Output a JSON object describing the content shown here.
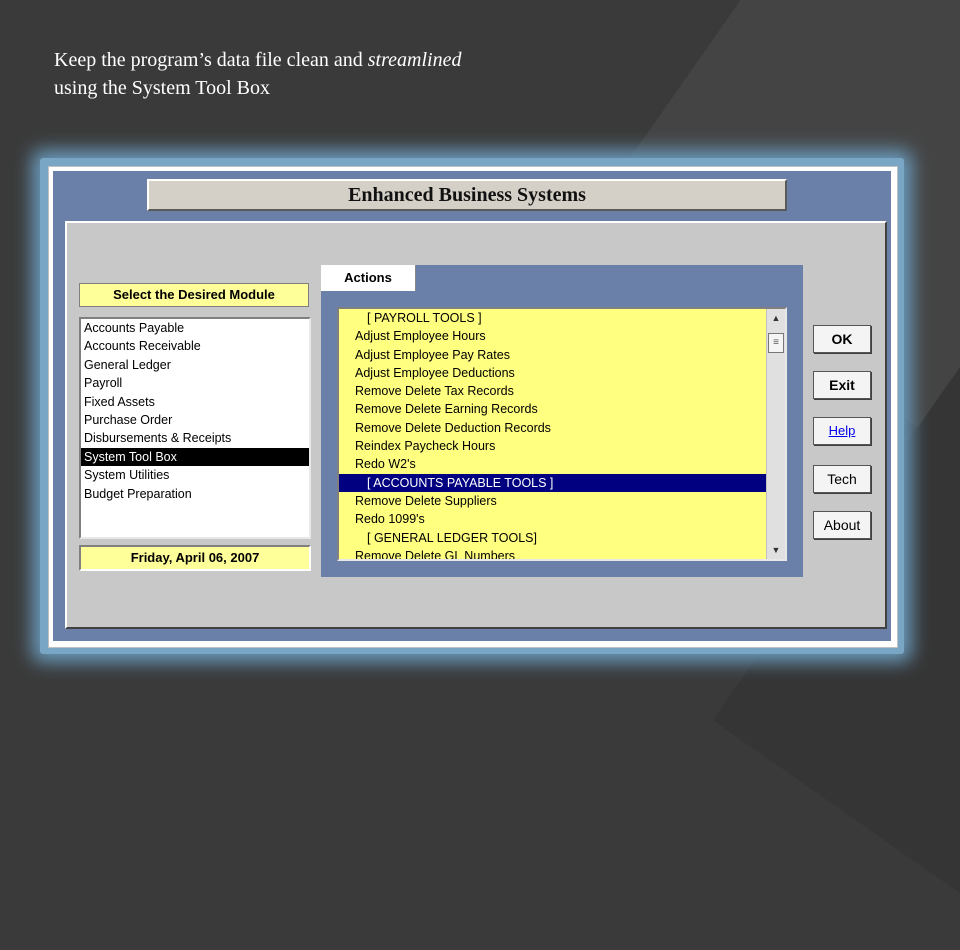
{
  "caption": {
    "line1_prefix": "Keep the program’s data file clean and ",
    "line1_emphasis": "streamlined",
    "line2": "using the System Tool Box"
  },
  "app": {
    "title": "Enhanced Business Systems"
  },
  "modules": {
    "header": "Select the Desired Module",
    "items": [
      "Accounts Payable",
      "Accounts Receivable",
      "General Ledger",
      "Payroll",
      "Fixed Assets",
      "Purchase Order",
      "Disbursements & Receipts",
      "System Tool Box",
      "System Utilities",
      "Budget Preparation"
    ],
    "selected": "System Tool Box",
    "date": "Friday, April 06, 2007"
  },
  "actions": {
    "tab_label": "Actions",
    "items": [
      "[ PAYROLL TOOLS ]",
      "Adjust Employee Hours",
      "Adjust Employee Pay Rates",
      "Adjust Employee Deductions",
      "Remove Delete Tax Records",
      "Remove Delete Earning Records",
      "Remove Delete Deduction Records",
      "Reindex Paycheck Hours",
      "Redo W2's",
      "[ ACCOUNTS PAYABLE TOOLS ]",
      "Remove Delete Suppliers",
      "Redo 1099's",
      "[ GENERAL LEDGER TOOLS]",
      "Remove Delete GL Numbers"
    ],
    "selected": "[ ACCOUNTS PAYABLE TOOLS ]"
  },
  "buttons": {
    "ok": "OK",
    "exit": "Exit",
    "help": "Help",
    "tech": "Tech",
    "about": "About"
  },
  "colors": {
    "list_yellow": "#ffff80",
    "selection_navy": "#000080",
    "frame_blue": "#6b80a8"
  }
}
